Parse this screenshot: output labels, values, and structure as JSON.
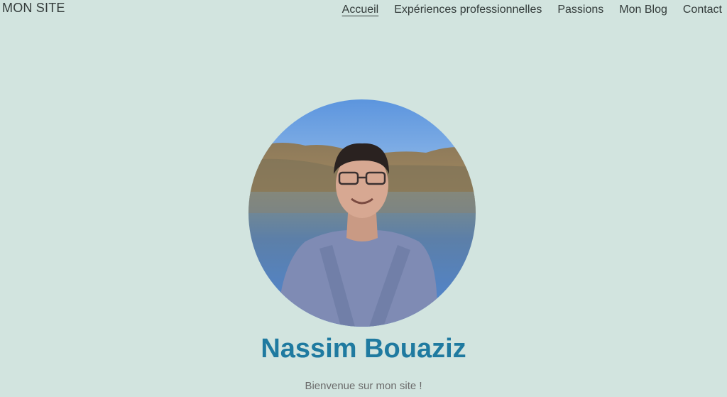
{
  "header": {
    "brand": "MON SITE",
    "nav": [
      {
        "label": "Accueil",
        "active": true
      },
      {
        "label": "Expériences professionnelles",
        "active": false
      },
      {
        "label": "Passions",
        "active": false
      },
      {
        "label": "Mon Blog",
        "active": false
      },
      {
        "label": "Contact",
        "active": false
      }
    ]
  },
  "hero": {
    "name": "Nassim Bouaziz",
    "welcome": "Bienvenue sur mon site !"
  },
  "colors": {
    "background": "#d2e4df",
    "name": "#1f7aa0",
    "text": "#333b3a"
  }
}
